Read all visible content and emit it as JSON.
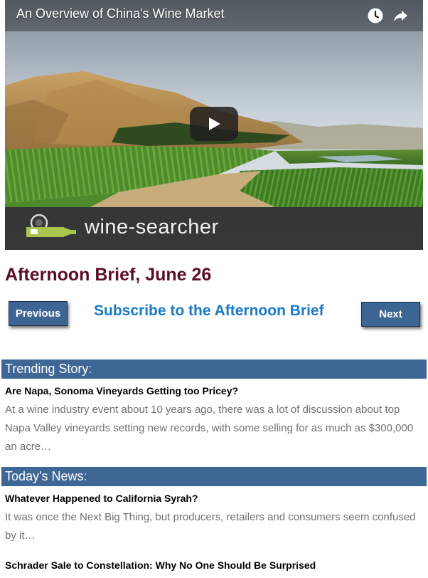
{
  "video": {
    "title": "An Overview of China's Wine Market",
    "brand_name": "wine-searcher",
    "controls": {
      "watch_later_icon": "clock-icon",
      "share_icon": "share-arrow-icon",
      "play_icon": "play-icon"
    }
  },
  "brief": {
    "title": "Afternoon Brief, June 26"
  },
  "nav": {
    "previous_label": "Previous",
    "subscribe_label": "Subscribe to the Afternoon Brief",
    "next_label": "Next"
  },
  "sections": {
    "trending": {
      "label": "Trending Story",
      "suffix": ":",
      "stories": [
        {
          "title": "Are Napa, Sonoma Vineyards Getting too Pricey?",
          "excerpt": "At a wine industry event about 10 years ago, there was a lot of discussion about top Napa Valley vineyards setting new records, with some selling for as much as $300,000 an acre…"
        }
      ]
    },
    "news": {
      "label": "Today's News",
      "suffix": ":",
      "stories": [
        {
          "title": "Whatever Happened to California Syrah?",
          "excerpt": "It was once the Next Big Thing, but producers, retailers and consumers seem confused by it…"
        },
        {
          "title": "Schrader Sale to Constellation: Why No One Should Be Surprised"
        }
      ]
    }
  },
  "colors": {
    "headline": "#5a0f25",
    "section_header_bg": "#3e6796",
    "button_bg": "#3d6593",
    "subscribe_link": "#1a7ac4",
    "excerpt_text": "#707070"
  }
}
